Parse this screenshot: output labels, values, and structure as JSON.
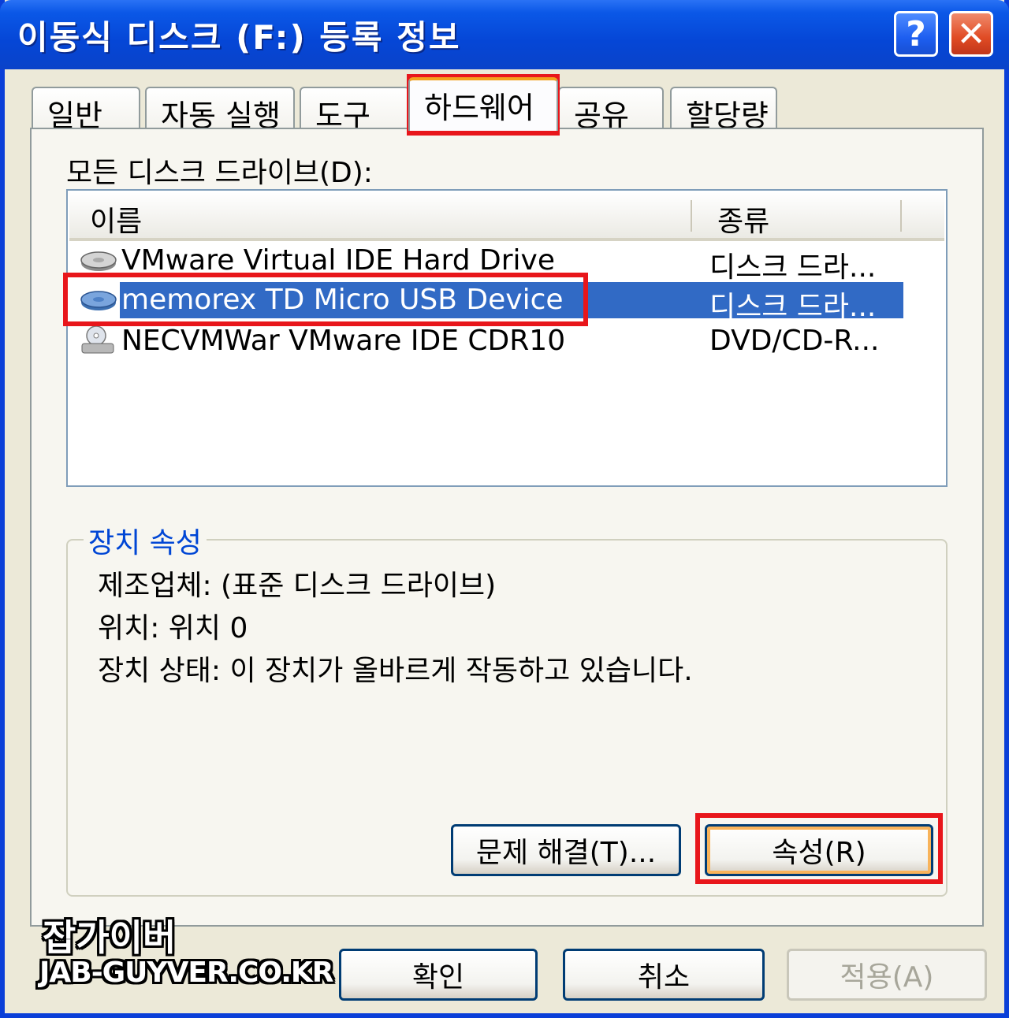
{
  "window": {
    "title": "이동식 디스크 (F:) 등록 정보",
    "help_glyph": "?",
    "close_glyph": "✕"
  },
  "tabs": [
    {
      "label": "일반"
    },
    {
      "label": "자동 실행"
    },
    {
      "label": "도구"
    },
    {
      "label": "하드웨어",
      "active": true
    },
    {
      "label": "공유"
    },
    {
      "label": "할당량"
    }
  ],
  "hardware": {
    "drives_label": "모든 디스크 드라이브(D):",
    "columns": {
      "name": "이름",
      "type": "종류"
    },
    "rows": [
      {
        "name": "VMware Virtual IDE Hard Drive",
        "type": "디스크 드라...",
        "icon": "hard-drive-icon"
      },
      {
        "name": "memorex TD Micro USB Device",
        "type": "디스크 드라...",
        "icon": "usb-drive-icon",
        "selected": true
      },
      {
        "name": "NECVMWar VMware IDE CDR10",
        "type": "DVD/CD-R...",
        "icon": "cd-drive-icon"
      }
    ],
    "properties_group": "장치 속성",
    "manufacturer": "제조업체: (표준 디스크 드라이브)",
    "location": "위치: 위치 0",
    "status": "장치 상태: 이 장치가 올바르게 작동하고 있습니다.",
    "troubleshoot_button": "문제 해결(T)...",
    "properties_button": "속성(R)"
  },
  "footer": {
    "ok": "확인",
    "cancel": "취소",
    "apply": "적용(A)"
  },
  "watermark": {
    "line1": "잡가이버",
    "line2": "JAB-GUYVER.CO.KR"
  },
  "colors": {
    "title_bar": "#0b58e7",
    "selection": "#316ac5",
    "highlight_box": "#e8161b",
    "group_label": "#0046d5"
  }
}
